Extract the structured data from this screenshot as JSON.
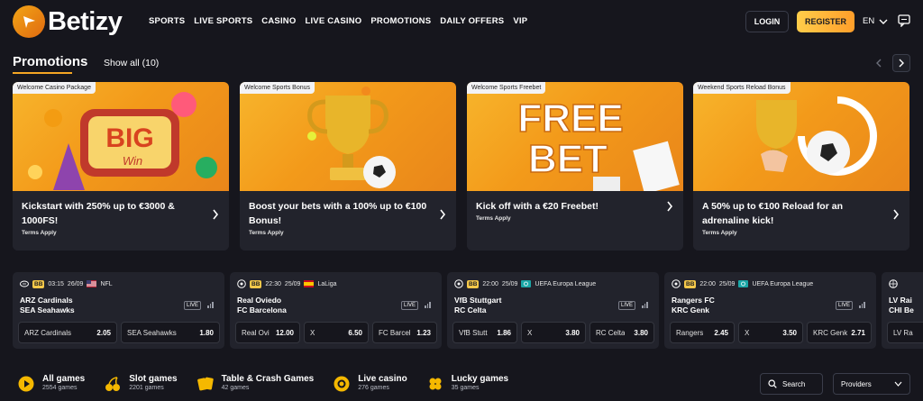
{
  "header": {
    "brand": "Betizy",
    "nav": [
      "SPORTS",
      "LIVE SPORTS",
      "CASINO",
      "LIVE CASINO",
      "PROMOTIONS",
      "DAILY OFFERS",
      "VIP"
    ],
    "login": "LOGIN",
    "register": "REGISTER",
    "lang": "EN"
  },
  "promotions": {
    "title": "Promotions",
    "show_all": "Show all (10)",
    "cards": [
      {
        "tag": "Welcome Casino Package",
        "text": "Kickstart with 250% up to €3000 & 1000FS!",
        "terms": "Terms Apply"
      },
      {
        "tag": "Welcome Sports Bonus",
        "text": "Boost your bets with a 100% up to €100 Bonus!",
        "terms": "Terms Apply"
      },
      {
        "tag": "Welcome Sports Freebet",
        "text": "Kick off with a €20 Freebet!",
        "terms": "Terms Apply"
      },
      {
        "tag": "Weekend Sports Reload Bonus",
        "text": "A 50% up to €100 Reload for an adrenaline kick!",
        "terms": "Terms Apply"
      }
    ],
    "art": {
      "big": "BIG",
      "win": "Win",
      "free": "FREE",
      "bet": "BET"
    }
  },
  "matches": [
    {
      "bb": "BB",
      "time": "03:15",
      "date": "26/09",
      "league": "NFL",
      "home": "ARZ Cardinals",
      "away": "SEA Seahawks",
      "live": "LIVE",
      "odds": [
        {
          "label": "ARZ Cardinals",
          "value": "2.05"
        },
        {
          "label": "SEA Seahawks",
          "value": "1.80"
        }
      ]
    },
    {
      "bb": "BB",
      "time": "22:30",
      "date": "25/09",
      "league": "LaLiga",
      "home": "Real Oviedo",
      "away": "FC Barcelona",
      "live": "LIVE",
      "odds": [
        {
          "label": "Real Ovi",
          "value": "12.00"
        },
        {
          "label": "X",
          "value": "6.50"
        },
        {
          "label": "FC Barcel",
          "value": "1.23"
        }
      ]
    },
    {
      "bb": "BB",
      "time": "22:00",
      "date": "25/09",
      "league": "UEFA Europa League",
      "home": "VfB Stuttgart",
      "away": "RC Celta",
      "live": "LIVE",
      "odds": [
        {
          "label": "VfB Stutt",
          "value": "1.86"
        },
        {
          "label": "X",
          "value": "3.80"
        },
        {
          "label": "RC Celta",
          "value": "3.80"
        }
      ]
    },
    {
      "bb": "BB",
      "time": "22:00",
      "date": "25/09",
      "league": "UEFA Europa League",
      "home": "Rangers FC",
      "away": "KRC Genk",
      "live": "LIVE",
      "odds": [
        {
          "label": "Rangers",
          "value": "2.45"
        },
        {
          "label": "X",
          "value": "3.50"
        },
        {
          "label": "KRC Genk",
          "value": "2.71"
        }
      ]
    },
    {
      "home": "LV Rai",
      "away": "CHI Be",
      "odds": [
        {
          "label": "LV Ra",
          "value": ""
        }
      ]
    }
  ],
  "categories": [
    {
      "name": "All games",
      "count": "2554 games",
      "icon": "play-icon"
    },
    {
      "name": "Slot games",
      "count": "2201 games",
      "icon": "cherry-icon"
    },
    {
      "name": "Table & Crash Games",
      "count": "42 games",
      "icon": "cards-icon"
    },
    {
      "name": "Live casino",
      "count": "276 games",
      "icon": "chip-icon"
    },
    {
      "name": "Lucky games",
      "count": "35 games",
      "icon": "clover-icon"
    }
  ],
  "search_label": "Search",
  "providers_label": "Providers",
  "colors": {
    "accent": "#f5a623",
    "bg": "#16161d",
    "card": "#22232c"
  }
}
